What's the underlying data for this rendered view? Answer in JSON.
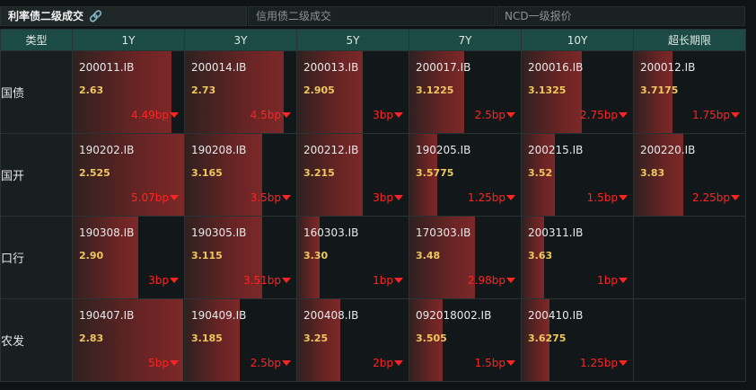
{
  "tabs": [
    {
      "label": "利率债二级成交"
    },
    {
      "label": "信用债二级成交"
    },
    {
      "label": "NCD一级报价"
    }
  ],
  "headers": [
    "类型",
    "1Y",
    "3Y",
    "5Y",
    "7Y",
    "10Y",
    "超长期限"
  ],
  "rows": [
    {
      "label": "国债",
      "cells": [
        {
          "code": "200011.IB",
          "yield": "2.63",
          "change": "4.49bp",
          "fill_pct": 89
        },
        {
          "code": "200014.IB",
          "yield": "2.73",
          "change": "4.5bp",
          "fill_pct": 89
        },
        {
          "code": "200013.IB",
          "yield": "2.905",
          "change": "3bp",
          "fill_pct": 59
        },
        {
          "code": "200017.IB",
          "yield": "3.1225",
          "change": "2.5bp",
          "fill_pct": 49
        },
        {
          "code": "200016.IB",
          "yield": "3.1325",
          "change": "2.75bp",
          "fill_pct": 54
        },
        {
          "code": "200012.IB",
          "yield": "3.7175",
          "change": "1.75bp",
          "fill_pct": 35
        }
      ]
    },
    {
      "label": "国开",
      "cells": [
        {
          "code": "190202.IB",
          "yield": "2.525",
          "change": "5.07bp",
          "fill_pct": 100
        },
        {
          "code": "190208.IB",
          "yield": "3.165",
          "change": "3.5bp",
          "fill_pct": 69
        },
        {
          "code": "200212.IB",
          "yield": "3.215",
          "change": "3bp",
          "fill_pct": 59
        },
        {
          "code": "190205.IB",
          "yield": "3.5775",
          "change": "1.25bp",
          "fill_pct": 25
        },
        {
          "code": "200215.IB",
          "yield": "3.52",
          "change": "1.5bp",
          "fill_pct": 30
        },
        {
          "code": "200220.IB",
          "yield": "3.83",
          "change": "2.25bp",
          "fill_pct": 44
        }
      ]
    },
    {
      "label": "口行",
      "cells": [
        {
          "code": "190308.IB",
          "yield": "2.90",
          "change": "3bp",
          "fill_pct": 59
        },
        {
          "code": "190305.IB",
          "yield": "3.115",
          "change": "3.51bp",
          "fill_pct": 69
        },
        {
          "code": "160303.IB",
          "yield": "3.30",
          "change": "1bp",
          "fill_pct": 20
        },
        {
          "code": "170303.IB",
          "yield": "3.48",
          "change": "2.98bp",
          "fill_pct": 59
        },
        {
          "code": "200311.IB",
          "yield": "3.63",
          "change": "1bp",
          "fill_pct": 20
        },
        null
      ]
    },
    {
      "label": "农发",
      "cells": [
        {
          "code": "190407.IB",
          "yield": "2.83",
          "change": "5bp",
          "fill_pct": 99
        },
        {
          "code": "190409.IB",
          "yield": "3.185",
          "change": "2.5bp",
          "fill_pct": 49
        },
        {
          "code": "200408.IB",
          "yield": "3.25",
          "change": "2bp",
          "fill_pct": 39
        },
        {
          "code": "092018002.IB",
          "yield": "3.505",
          "change": "1.5bp",
          "fill_pct": 30
        },
        {
          "code": "200410.IB",
          "yield": "3.6275",
          "change": "1.25bp",
          "fill_pct": 25
        },
        null
      ]
    }
  ],
  "colors": {
    "bar": "#7c2828",
    "yield": "#f0c75e",
    "change": "#ff2424",
    "header": "#1c4a44"
  },
  "icons": {
    "tab_link": "link-icon",
    "change_direction": "triangle-down-icon"
  }
}
